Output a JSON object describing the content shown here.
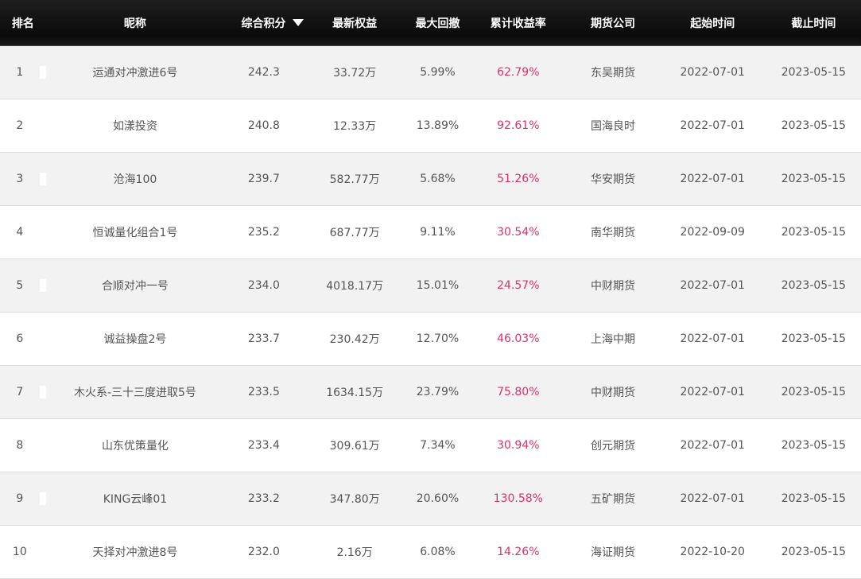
{
  "header": {
    "rank": "排名",
    "nickname": "昵称",
    "score": "综合积分",
    "equity": "最新权益",
    "drawdown": "最大回撤",
    "return_rate": "累计收益率",
    "broker": "期货公司",
    "start": "起始时间",
    "end": "截止时间",
    "sort_icon": "caret-down-icon"
  },
  "colors": {
    "return_rate": "#e0306d",
    "header_bg": "#111111",
    "row_alt": "#f2f2f2"
  },
  "rows": [
    {
      "rank": "1",
      "nickname": "运通对冲激进6号",
      "score": "242.3",
      "equity": "33.72万",
      "drawdown": "5.99%",
      "return_rate": "62.79%",
      "broker": "东吴期货",
      "start": "2022-07-01",
      "end": "2023-05-15"
    },
    {
      "rank": "2",
      "nickname": "如漾投资",
      "score": "240.8",
      "equity": "12.33万",
      "drawdown": "13.89%",
      "return_rate": "92.61%",
      "broker": "国海良时",
      "start": "2022-07-01",
      "end": "2023-05-15"
    },
    {
      "rank": "3",
      "nickname": "沧海100",
      "score": "239.7",
      "equity": "582.77万",
      "drawdown": "5.68%",
      "return_rate": "51.26%",
      "broker": "华安期货",
      "start": "2022-07-01",
      "end": "2023-05-15"
    },
    {
      "rank": "4",
      "nickname": "恒诚量化组合1号",
      "score": "235.2",
      "equity": "687.77万",
      "drawdown": "9.11%",
      "return_rate": "30.54%",
      "broker": "南华期货",
      "start": "2022-09-09",
      "end": "2023-05-15"
    },
    {
      "rank": "5",
      "nickname": "合顺对冲一号",
      "score": "234.0",
      "equity": "4018.17万",
      "drawdown": "15.01%",
      "return_rate": "24.57%",
      "broker": "中财期货",
      "start": "2022-07-01",
      "end": "2023-05-15"
    },
    {
      "rank": "6",
      "nickname": "诚益操盘2号",
      "score": "233.7",
      "equity": "230.42万",
      "drawdown": "12.70%",
      "return_rate": "46.03%",
      "broker": "上海中期",
      "start": "2022-07-01",
      "end": "2023-05-15"
    },
    {
      "rank": "7",
      "nickname": "木火系-三十三度进取5号",
      "score": "233.5",
      "equity": "1634.15万",
      "drawdown": "23.79%",
      "return_rate": "75.80%",
      "broker": "中财期货",
      "start": "2022-07-01",
      "end": "2023-05-15"
    },
    {
      "rank": "8",
      "nickname": "山东优策量化",
      "score": "233.4",
      "equity": "309.61万",
      "drawdown": "7.34%",
      "return_rate": "30.94%",
      "broker": "创元期货",
      "start": "2022-07-01",
      "end": "2023-05-15"
    },
    {
      "rank": "9",
      "nickname": "KING云峰01",
      "score": "233.2",
      "equity": "347.80万",
      "drawdown": "20.60%",
      "return_rate": "130.58%",
      "broker": "五矿期货",
      "start": "2022-07-01",
      "end": "2023-05-15"
    },
    {
      "rank": "10",
      "nickname": "天择对冲激进8号",
      "score": "232.0",
      "equity": "2.16万",
      "drawdown": "6.08%",
      "return_rate": "14.26%",
      "broker": "海证期货",
      "start": "2022-10-20",
      "end": "2023-05-15"
    }
  ]
}
